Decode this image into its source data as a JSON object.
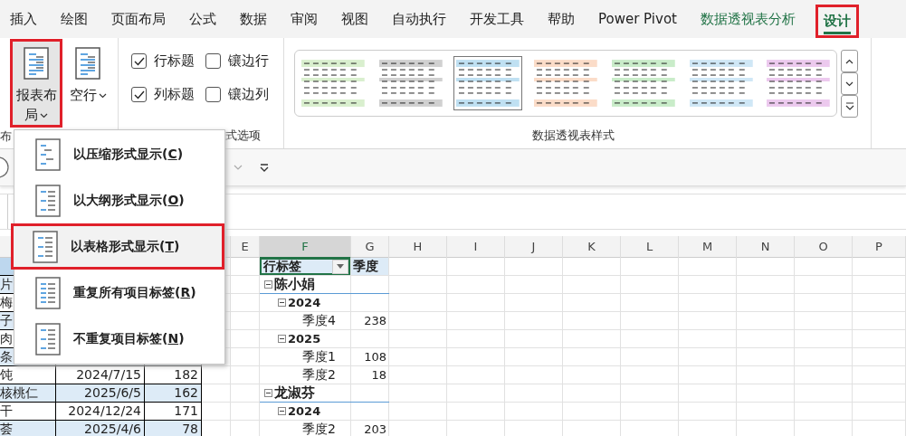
{
  "tabs": [
    {
      "label": "插入",
      "selected": false,
      "contextual": false,
      "highlighted": false
    },
    {
      "label": "绘图",
      "selected": false,
      "contextual": false,
      "highlighted": false
    },
    {
      "label": "页面布局",
      "selected": false,
      "contextual": false,
      "highlighted": false
    },
    {
      "label": "公式",
      "selected": false,
      "contextual": false,
      "highlighted": false
    },
    {
      "label": "数据",
      "selected": false,
      "contextual": false,
      "highlighted": false
    },
    {
      "label": "审阅",
      "selected": false,
      "contextual": false,
      "highlighted": false
    },
    {
      "label": "视图",
      "selected": false,
      "contextual": false,
      "highlighted": false
    },
    {
      "label": "自动执行",
      "selected": false,
      "contextual": false,
      "highlighted": false
    },
    {
      "label": "开发工具",
      "selected": false,
      "contextual": false,
      "highlighted": false
    },
    {
      "label": "帮助",
      "selected": false,
      "contextual": false,
      "highlighted": false
    },
    {
      "label": "Power Pivot",
      "selected": false,
      "contextual": false,
      "highlighted": false
    },
    {
      "label": "数据透视表分析",
      "selected": false,
      "contextual": true,
      "highlighted": false
    },
    {
      "label": "设计",
      "selected": true,
      "contextual": true,
      "highlighted": true
    }
  ],
  "ribbon": {
    "layout_group": {
      "label": "布",
      "buttons": [
        {
          "label": "报表布局",
          "pressed": true,
          "highlighted": true
        },
        {
          "label": "空行",
          "pressed": false,
          "highlighted": false
        }
      ]
    },
    "options_group": {
      "label": "式选项",
      "checkboxes": [
        {
          "label": "行标题",
          "checked": true
        },
        {
          "label": "镶边行",
          "checked": false
        },
        {
          "label": "列标题",
          "checked": true
        },
        {
          "label": "镶边列",
          "checked": false
        }
      ]
    },
    "styles_group": {
      "label": "数据透视表样式",
      "styles": [
        {
          "color": "#d9efce",
          "selected": false
        },
        {
          "color": "#d0d0d0",
          "selected": false
        },
        {
          "color": "#bfe0f2",
          "selected": true
        },
        {
          "color": "#fbdcc8",
          "selected": false
        },
        {
          "color": "#c9ecc9",
          "selected": false
        },
        {
          "color": "#cfe7f6",
          "selected": false
        },
        {
          "color": "#ecc9ee",
          "selected": false
        }
      ]
    }
  },
  "layout_menu": {
    "items": [
      {
        "label": "以压缩形式显示(C)",
        "highlighted": false
      },
      {
        "label": "以大纲形式显示(O)",
        "highlighted": false
      },
      {
        "label": "以表格形式显示(T)",
        "highlighted": true
      },
      {
        "label": "重复所有项目标签(R)",
        "highlighted": false
      },
      {
        "label": "不重复项目标签(N)",
        "highlighted": false
      }
    ]
  },
  "sheet": {
    "column_headers": [
      {
        "label": "E",
        "selected": false
      },
      {
        "label": "F",
        "selected": true
      },
      {
        "label": "G",
        "selected": false
      },
      {
        "label": "H",
        "selected": false
      },
      {
        "label": "I",
        "selected": false
      },
      {
        "label": "J",
        "selected": false
      },
      {
        "label": "K",
        "selected": false
      },
      {
        "label": "L",
        "selected": false
      },
      {
        "label": "M",
        "selected": false
      },
      {
        "label": "N",
        "selected": false
      },
      {
        "label": "O",
        "selected": false
      },
      {
        "label": "P",
        "selected": false
      }
    ],
    "data_table": {
      "rows": [
        {
          "cells": [
            "片"
          ]
        },
        {
          "cells": [
            "梅"
          ]
        },
        {
          "cells": [
            "子"
          ]
        },
        {
          "cells": [
            "肉"
          ]
        },
        {
          "cells": [
            "条"
          ]
        },
        {
          "cells": [
            "饨",
            "2024/7/15",
            "182"
          ]
        },
        {
          "cells": [
            "核桃仁",
            "2025/6/5",
            "162"
          ]
        },
        {
          "cells": [
            "干",
            "2024/12/24",
            "171"
          ]
        },
        {
          "cells": [
            "荟",
            "2025/4/6",
            "78"
          ]
        }
      ]
    },
    "pivot": {
      "header": {
        "label": "行标签",
        "column_2": "季度"
      },
      "rows": [
        {
          "label": "陈小娟",
          "expanded": true,
          "children": [
            {
              "label": "2024",
              "expanded": true,
              "children": [
                {
                  "label": "季度4",
                  "value": "238"
                }
              ]
            },
            {
              "label": "2025",
              "expanded": true,
              "children": [
                {
                  "label": "季度1",
                  "value": "108"
                },
                {
                  "label": "季度2",
                  "value": "18"
                }
              ]
            }
          ]
        },
        {
          "label": "龙淑芬",
          "expanded": true,
          "children": [
            {
              "label": "2024",
              "expanded": true,
              "children": [
                {
                  "label": "季度2",
                  "value": "203"
                }
              ]
            }
          ]
        }
      ]
    }
  }
}
